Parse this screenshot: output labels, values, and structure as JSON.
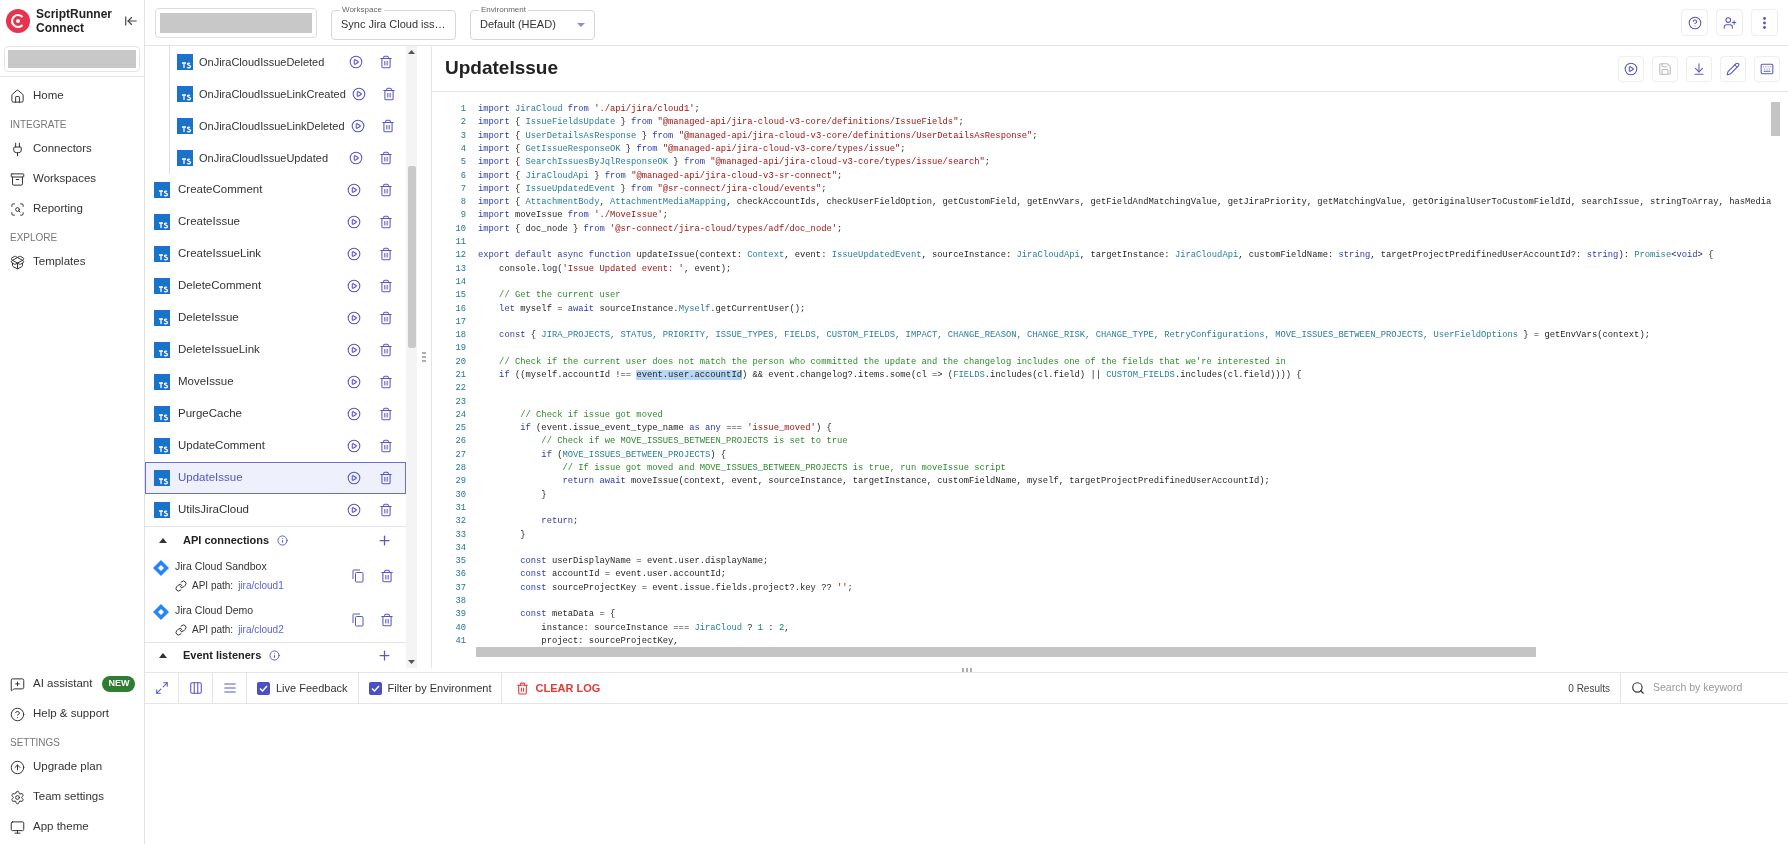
{
  "app": {
    "name": "ScriptRunner Connect"
  },
  "nav_top": [
    {
      "kind": "item",
      "label": "Home"
    },
    {
      "kind": "heading",
      "label": "INTEGRATE"
    },
    {
      "kind": "item",
      "label": "Connectors"
    },
    {
      "kind": "item",
      "label": "Workspaces"
    },
    {
      "kind": "item",
      "label": "Reporting"
    },
    {
      "kind": "heading",
      "label": "EXPLORE"
    },
    {
      "kind": "item",
      "label": "Templates"
    }
  ],
  "nav_bottom": [
    {
      "kind": "item",
      "label": "AI assistant",
      "badge": "NEW"
    },
    {
      "kind": "item",
      "label": "Help & support"
    },
    {
      "kind": "heading",
      "label": "SETTINGS"
    },
    {
      "kind": "item",
      "label": "Upgrade plan"
    },
    {
      "kind": "item",
      "label": "Team settings"
    },
    {
      "kind": "item",
      "label": "App theme"
    }
  ],
  "topbar": {
    "workspace": {
      "label": "Workspace",
      "value": "Sync Jira Cloud iss…"
    },
    "environment": {
      "label": "Environment",
      "value": "Default (HEAD)"
    }
  },
  "scripts": [
    {
      "children": [
        {
          "name": "OnJiraCloudIssueDeleted",
          "selected": false
        },
        {
          "name": "OnJiraCloudIssueLinkCreated",
          "selected": false
        },
        {
          "name": "OnJiraCloudIssueLinkDeleted",
          "selected": false
        },
        {
          "name": "OnJiraCloudIssueUpdated",
          "selected": false
        }
      ]
    },
    {
      "name": "CreateComment",
      "selected": false
    },
    {
      "name": "CreateIssue",
      "selected": false
    },
    {
      "name": "CreateIssueLink",
      "selected": false
    },
    {
      "name": "DeleteComment",
      "selected": false
    },
    {
      "name": "DeleteIssue",
      "selected": false
    },
    {
      "name": "DeleteIssueLink",
      "selected": false
    },
    {
      "name": "MoveIssue",
      "selected": false
    },
    {
      "name": "PurgeCache",
      "selected": false
    },
    {
      "name": "UpdateComment",
      "selected": false
    },
    {
      "name": "UpdateIssue",
      "selected": true
    },
    {
      "name": "UtilsJiraCloud",
      "selected": false
    }
  ],
  "api_connections": {
    "title": "API connections",
    "expanded": true,
    "items": [
      {
        "name": "Jira Cloud Sandbox",
        "path_label": "API path:",
        "path": "jira/cloud1"
      },
      {
        "name": "Jira Cloud Demo",
        "path_label": "API path:",
        "path": "jira/cloud2"
      }
    ]
  },
  "event_listeners": {
    "title": "Event listeners",
    "expanded": true
  },
  "editor": {
    "title": "UpdateIssue",
    "actions": [
      {
        "disabled": false
      },
      {
        "disabled": true
      },
      {
        "disabled": false
      },
      {
        "disabled": false
      },
      {
        "disabled": false
      }
    ],
    "lines": [
      {
        "n": "1",
        "t": [
          {
            "kind": "kw",
            "text": "import "
          },
          {
            "kind": "type",
            "text": "JiraCloud"
          },
          {
            "kind": "kw",
            "text": " from "
          },
          {
            "kind": "str",
            "text": "'./api/jira/cloud1'"
          },
          {
            "kind": "plain",
            "text": ";"
          }
        ]
      },
      {
        "n": "2",
        "t": [
          {
            "kind": "kw",
            "text": "import "
          },
          {
            "kind": "plain",
            "text": "{ "
          },
          {
            "kind": "type",
            "text": "IssueFieldsUpdate"
          },
          {
            "kind": "plain",
            "text": " } "
          },
          {
            "kind": "kw",
            "text": "from "
          },
          {
            "kind": "str",
            "text": "\"@managed-api/jira-cloud-v3-core/definitions/IssueFields\""
          },
          {
            "kind": "plain",
            "text": ";"
          }
        ]
      },
      {
        "n": "3",
        "t": [
          {
            "kind": "kw",
            "text": "import "
          },
          {
            "kind": "plain",
            "text": "{ "
          },
          {
            "kind": "type",
            "text": "UserDetailsAsResponse"
          },
          {
            "kind": "plain",
            "text": " } "
          },
          {
            "kind": "kw",
            "text": "from "
          },
          {
            "kind": "str",
            "text": "\"@managed-api/jira-cloud-v3-core/definitions/UserDetailsAsResponse\""
          },
          {
            "kind": "plain",
            "text": ";"
          }
        ]
      },
      {
        "n": "4",
        "t": [
          {
            "kind": "kw",
            "text": "import "
          },
          {
            "kind": "plain",
            "text": "{ "
          },
          {
            "kind": "type",
            "text": "GetIssueResponseOK"
          },
          {
            "kind": "plain",
            "text": " } "
          },
          {
            "kind": "kw",
            "text": "from "
          },
          {
            "kind": "str",
            "text": "\"@managed-api/jira-cloud-v3-core/types/issue\""
          },
          {
            "kind": "plain",
            "text": ";"
          }
        ]
      },
      {
        "n": "5",
        "t": [
          {
            "kind": "kw",
            "text": "import "
          },
          {
            "kind": "plain",
            "text": "{ "
          },
          {
            "kind": "type",
            "text": "SearchIssuesByJqlResponseOK"
          },
          {
            "kind": "plain",
            "text": " } "
          },
          {
            "kind": "kw",
            "text": "from "
          },
          {
            "kind": "str",
            "text": "\"@managed-api/jira-cloud-v3-core/types/issue/search\""
          },
          {
            "kind": "plain",
            "text": ";"
          }
        ]
      },
      {
        "n": "6",
        "t": [
          {
            "kind": "kw",
            "text": "import "
          },
          {
            "kind": "plain",
            "text": "{ "
          },
          {
            "kind": "type",
            "text": "JiraCloudApi"
          },
          {
            "kind": "plain",
            "text": " } "
          },
          {
            "kind": "kw",
            "text": "from "
          },
          {
            "kind": "str",
            "text": "\"@managed-api/jira-cloud-v3-sr-connect\""
          },
          {
            "kind": "plain",
            "text": ";"
          }
        ]
      },
      {
        "n": "7",
        "t": [
          {
            "kind": "kw",
            "text": "import "
          },
          {
            "kind": "plain",
            "text": "{ "
          },
          {
            "kind": "type",
            "text": "IssueUpdatedEvent"
          },
          {
            "kind": "plain",
            "text": " } "
          },
          {
            "kind": "kw",
            "text": "from "
          },
          {
            "kind": "str",
            "text": "\"@sr-connect/jira-cloud/events\""
          },
          {
            "kind": "plain",
            "text": ";"
          }
        ]
      },
      {
        "n": "8",
        "t": [
          {
            "kind": "kw",
            "text": "import "
          },
          {
            "kind": "plain",
            "text": "{ "
          },
          {
            "kind": "type",
            "text": "AttachmentBody"
          },
          {
            "kind": "plain",
            "text": ", "
          },
          {
            "kind": "type",
            "text": "AttachmentMediaMapping"
          },
          {
            "kind": "plain",
            "text": ", checkAccountIds, checkUserFieldOption, getCustomField, getEnvVars, getFieldAndMatchingValue, getJiraPriority, getMatchingValue, getOriginalUserToCustomFieldId, searchIssue, stringToArray, hasMedia"
          }
        ]
      },
      {
        "n": "9",
        "t": [
          {
            "kind": "kw",
            "text": "import "
          },
          {
            "kind": "plain",
            "text": "moveIssue "
          },
          {
            "kind": "kw",
            "text": "from "
          },
          {
            "kind": "str",
            "text": "'./MoveIssue'"
          },
          {
            "kind": "plain",
            "text": ";"
          }
        ]
      },
      {
        "n": "10",
        "t": [
          {
            "kind": "kw",
            "text": "import "
          },
          {
            "kind": "plain",
            "text": "{ doc_node } "
          },
          {
            "kind": "kw",
            "text": "from "
          },
          {
            "kind": "str",
            "text": "'@sr-connect/jira-cloud/types/adf/doc_node'"
          },
          {
            "kind": "plain",
            "text": ";"
          }
        ]
      },
      {
        "n": "11"
      },
      {
        "n": "12",
        "t": [
          {
            "kind": "kw",
            "text": "export default async function "
          },
          {
            "kind": "plain",
            "text": "updateIssue(context: "
          },
          {
            "kind": "type",
            "text": "Context"
          },
          {
            "kind": "plain",
            "text": ", event: "
          },
          {
            "kind": "type",
            "text": "IssueUpdatedEvent"
          },
          {
            "kind": "plain",
            "text": ", sourceInstance: "
          },
          {
            "kind": "type",
            "text": "JiraCloudApi"
          },
          {
            "kind": "plain",
            "text": ", targetInstance: "
          },
          {
            "kind": "type",
            "text": "JiraCloudApi"
          },
          {
            "kind": "plain",
            "text": ", customFieldName: "
          },
          {
            "kind": "kw",
            "text": "string"
          },
          {
            "kind": "plain",
            "text": ", targetProjectPredifinedUserAccountId?: "
          },
          {
            "kind": "kw",
            "text": "string"
          },
          {
            "kind": "plain",
            "text": "): "
          },
          {
            "kind": "type",
            "text": "Promise"
          },
          {
            "kind": "plain",
            "text": "<"
          },
          {
            "kind": "kw",
            "text": "void"
          },
          {
            "kind": "plain",
            "text": "> {"
          }
        ]
      },
      {
        "n": "13",
        "t": [
          {
            "kind": "plain",
            "text": "    console.log("
          },
          {
            "kind": "str",
            "text": "'Issue Updated event: '"
          },
          {
            "kind": "plain",
            "text": ", event);"
          }
        ]
      },
      {
        "n": "14"
      },
      {
        "n": "15",
        "t": [
          {
            "kind": "comment",
            "text": "    // Get the current user"
          }
        ]
      },
      {
        "n": "16",
        "t": [
          {
            "kind": "kw",
            "text": "    let "
          },
          {
            "kind": "plain",
            "text": "myself = "
          },
          {
            "kind": "kw",
            "text": "await "
          },
          {
            "kind": "plain",
            "text": "sourceInstance."
          },
          {
            "kind": "type",
            "text": "Myself"
          },
          {
            "kind": "plain",
            "text": ".getCurrentUser();"
          }
        ]
      },
      {
        "n": "17"
      },
      {
        "n": "18",
        "t": [
          {
            "kind": "kw",
            "text": "    const "
          },
          {
            "kind": "plain",
            "text": "{ "
          },
          {
            "kind": "type",
            "text": "JIRA_PROJECTS, STATUS, PRIORITY, ISSUE_TYPES, FIELDS, CUSTOM_FIELDS, IMPACT, CHANGE_REASON, CHANGE_RISK, CHANGE_TYPE, RetryConfigurations, MOVE_ISSUES_BETWEEN_PROJECTS, UserFieldOptions"
          },
          {
            "kind": "plain",
            "text": " } = getEnvVars(context);"
          }
        ]
      },
      {
        "n": "19"
      },
      {
        "n": "20",
        "t": [
          {
            "kind": "comment",
            "text": "    // Check if the current user does not match the person who committed the update and the changelog includes one of the fields that we're interested in"
          }
        ]
      },
      {
        "n": "21",
        "t": [
          {
            "kind": "kw",
            "text": "    if "
          },
          {
            "kind": "plain",
            "text": "((myself.accountId !== "
          },
          {
            "kind": "highlight",
            "text": "event.user.accountId"
          },
          {
            "kind": "plain",
            "text": ") && event.changelog?.items.some(cl => ("
          },
          {
            "kind": "type",
            "text": "FIELDS"
          },
          {
            "kind": "plain",
            "text": ".includes(cl.field) || "
          },
          {
            "kind": "type",
            "text": "CUSTOM_FIELDS"
          },
          {
            "kind": "plain",
            "text": ".includes(cl.field)))) {"
          }
        ]
      },
      {
        "n": "22"
      },
      {
        "n": "23"
      },
      {
        "n": "24",
        "t": [
          {
            "kind": "comment",
            "text": "        // Check if issue got moved"
          }
        ]
      },
      {
        "n": "25",
        "t": [
          {
            "kind": "kw",
            "text": "        if "
          },
          {
            "kind": "plain",
            "text": "(event.issue_event_type_name "
          },
          {
            "kind": "kw",
            "text": "as any "
          },
          {
            "kind": "plain",
            "text": "=== "
          },
          {
            "kind": "str",
            "text": "'issue_moved'"
          },
          {
            "kind": "plain",
            "text": ") {"
          }
        ]
      },
      {
        "n": "26",
        "t": [
          {
            "kind": "comment",
            "text": "            // Check if we MOVE_ISSUES_BETWEEN_PROJECTS is set to true"
          }
        ]
      },
      {
        "n": "27",
        "t": [
          {
            "kind": "kw",
            "text": "            if "
          },
          {
            "kind": "plain",
            "text": "("
          },
          {
            "kind": "type",
            "text": "MOVE_ISSUES_BETWEEN_PROJECTS"
          },
          {
            "kind": "plain",
            "text": ") {"
          }
        ]
      },
      {
        "n": "28",
        "t": [
          {
            "kind": "comment",
            "text": "                // If issue got moved and MOVE_ISSUES_BETWEEN_PROJECTS is true, run moveIssue script"
          }
        ]
      },
      {
        "n": "29",
        "t": [
          {
            "kind": "kw",
            "text": "                return await "
          },
          {
            "kind": "plain",
            "text": "moveIssue(context, event, sourceInstance, targetInstance, customFieldName, myself, targetProjectPredifinedUserAccountId);"
          }
        ]
      },
      {
        "n": "30",
        "t": [
          {
            "kind": "plain",
            "text": "            }"
          }
        ]
      },
      {
        "n": "31"
      },
      {
        "n": "32",
        "t": [
          {
            "kind": "kw",
            "text": "            return"
          },
          {
            "kind": "plain",
            "text": ";"
          }
        ]
      },
      {
        "n": "33",
        "t": [
          {
            "kind": "plain",
            "text": "        }"
          }
        ]
      },
      {
        "n": "34"
      },
      {
        "n": "35",
        "t": [
          {
            "kind": "kw",
            "text": "        const "
          },
          {
            "kind": "plain",
            "text": "userDisplayName = event.user.displayName;"
          }
        ]
      },
      {
        "n": "36",
        "t": [
          {
            "kind": "kw",
            "text": "        const "
          },
          {
            "kind": "plain",
            "text": "accountId = event.user.accountId;"
          }
        ]
      },
      {
        "n": "37",
        "t": [
          {
            "kind": "kw",
            "text": "        const "
          },
          {
            "kind": "plain",
            "text": "sourceProjectKey = event.issue.fields.project?.key ?? "
          },
          {
            "kind": "str",
            "text": "''"
          },
          {
            "kind": "plain",
            "text": ";"
          }
        ]
      },
      {
        "n": "38"
      },
      {
        "n": "39",
        "t": [
          {
            "kind": "kw",
            "text": "        const "
          },
          {
            "kind": "plain",
            "text": "metaData = {"
          }
        ]
      },
      {
        "n": "40",
        "t": [
          {
            "kind": "plain",
            "text": "            instance: sourceInstance === "
          },
          {
            "kind": "type",
            "text": "JiraCloud"
          },
          {
            "kind": "plain",
            "text": " ? "
          },
          {
            "kind": "num",
            "text": "1"
          },
          {
            "kind": "plain",
            "text": " : "
          },
          {
            "kind": "num",
            "text": "2"
          },
          {
            "kind": "plain",
            "text": ","
          }
        ]
      },
      {
        "n": "41",
        "t": [
          {
            "kind": "plain",
            "text": "            project: sourceProjectKey,"
          }
        ]
      }
    ]
  },
  "log": {
    "live_feedback": {
      "label": "Live Feedback",
      "checked": true
    },
    "filter_by_environment": {
      "label": "Filter by Environment",
      "checked": true
    },
    "clear": "CLEAR LOG",
    "results": "0 Results",
    "search_placeholder": "Search by keyword"
  }
}
